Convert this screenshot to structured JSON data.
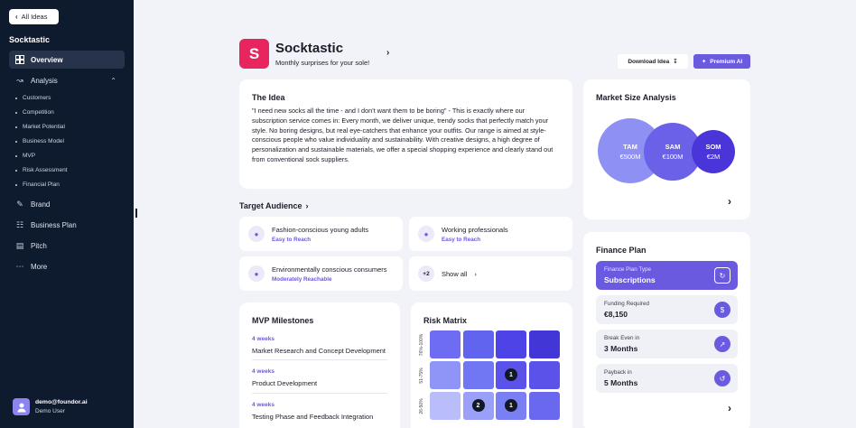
{
  "sidebar": {
    "back_label": "All Ideas",
    "app_name": "Socktastic",
    "nav": {
      "overview": "Overview",
      "analysis": "Analysis",
      "brand": "Brand",
      "business_plan": "Business Plan",
      "pitch": "Pitch",
      "more": "More"
    },
    "analysis_items": [
      "Customers",
      "Competition",
      "Market Potential",
      "Business Model",
      "MVP",
      "Risk Assessment",
      "Financial Plan"
    ],
    "user": {
      "email": "demo@foundor.ai",
      "role": "Demo User"
    }
  },
  "header": {
    "logo_letter": "S",
    "title": "Socktastic",
    "subtitle": "Monthly surprises for your sole!",
    "download_label": "Download Idea",
    "premium_label": "Premium AI"
  },
  "idea": {
    "title": "The Idea",
    "text": "\"I need new socks all the time - and I don't want them to be boring\" - This is exactly where our subscription service comes in: Every month, we deliver unique, trendy socks that perfectly match your style. No boring designs, but real eye-catchers that enhance your outfits. Our range is aimed at style-conscious people who value individuality and sustainability. With creative designs, a high degree of personalization and sustainable materials, we offer a special shopping experience and clearly stand out from conventional sock suppliers."
  },
  "audience": {
    "title": "Target Audience",
    "items": [
      {
        "name": "Fashion-conscious young adults",
        "reach": "Easy to Reach"
      },
      {
        "name": "Working professionals",
        "reach": "Easy to Reach"
      },
      {
        "name": "Environmentally conscious consumers",
        "reach": "Moderately Reachable"
      }
    ],
    "more_count": "+2",
    "show_all": "Show all"
  },
  "milestones": {
    "title": "MVP Milestones",
    "items": [
      {
        "weeks": "4 weeks",
        "name": "Market Research and Concept Development"
      },
      {
        "weeks": "4 weeks",
        "name": "Product Development"
      },
      {
        "weeks": "4 weeks",
        "name": "Testing Phase and Feedback Integration"
      }
    ]
  },
  "risk": {
    "title": "Risk Matrix",
    "row_labels": [
      "76%-100%",
      "51-75%",
      "26-50%"
    ],
    "rows": [
      [
        "#6d6cf3",
        "#6164ef",
        "#4e43e6",
        "#4336d6"
      ],
      [
        "#8f95f6",
        "#7176f3",
        "#5b52ea",
        "#5b52ea"
      ],
      [
        "#b9bdf9",
        "#9aa0f7",
        "#7a7ff4",
        "#6a68ef"
      ]
    ],
    "markers": [
      {
        "row": 1,
        "col": 2,
        "value": "1"
      },
      {
        "row": 2,
        "col": 1,
        "value": "2"
      },
      {
        "row": 2,
        "col": 2,
        "value": "1"
      }
    ]
  },
  "market": {
    "title": "Market Size Analysis",
    "tam": {
      "label": "TAM",
      "value": "€500M",
      "color": "#8e90f4"
    },
    "sam": {
      "label": "SAM",
      "value": "€100M",
      "color": "#6a61e8"
    },
    "som": {
      "label": "SOM",
      "value": "€2M",
      "color": "#4a35d8"
    }
  },
  "finance": {
    "title": "Finance Plan",
    "items": [
      {
        "label": "Finance Plan Type",
        "value": "Subscriptions",
        "icon": "refresh-icon"
      },
      {
        "label": "Funding Required",
        "value": "€8,150",
        "icon": "money-bag-icon"
      },
      {
        "label": "Break Even in",
        "value": "3 Months",
        "icon": "trend-icon"
      },
      {
        "label": "Payback in",
        "value": "5 Months",
        "icon": "cycle-icon"
      }
    ]
  }
}
